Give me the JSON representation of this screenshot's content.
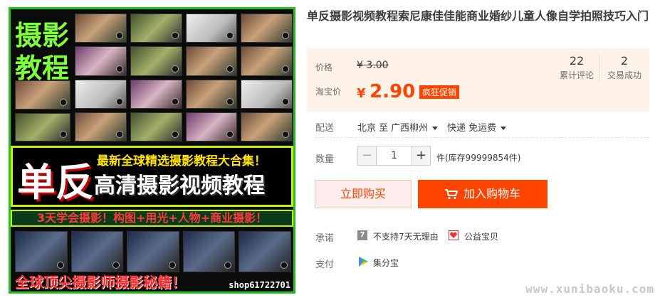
{
  "image": {
    "big_text_1": "摄影",
    "big_text_2": "教程",
    "banner_big": "单反",
    "banner_line1": "最新全球精选摄影教程大合集！",
    "banner_line2": "高清摄影视频教程",
    "strip_text": "3天学会摄影！构图+用光+人物+商业摄影！",
    "bottom_text": "全球顶尖摄影师摄影秘籍！",
    "shop_id": "shop61722701"
  },
  "product": {
    "title": "单反摄影视频教程索尼康佳佳能商业婚纱儿童人像自学拍照技巧入门"
  },
  "price": {
    "price_label": "价格",
    "original": "¥ 3.00",
    "taobao_label": "淘宝价",
    "currency": "¥",
    "current": "2.90",
    "promo_tag": "疯狂促销",
    "reviews_count": "22",
    "reviews_label": "累计评论",
    "deals_count": "2",
    "deals_label": "交易成功"
  },
  "delivery": {
    "label": "配送",
    "from": "北京 至",
    "to": "广西柳州",
    "method": "快递 免运费"
  },
  "quantity": {
    "label": "数量",
    "minus": "−",
    "value": "1",
    "plus": "+",
    "stock": "件(库存99999854件)"
  },
  "actions": {
    "buy_now": "立即购买",
    "add_cart": "加入购物车"
  },
  "promise": {
    "label": "承诺",
    "item1": "不支持7天无理由",
    "item1_icon": "7",
    "item2": "公益宝贝"
  },
  "payment": {
    "label": "支付",
    "item1": "集分宝"
  },
  "watermark": "www.xunibaoku.com",
  "colors": {
    "accent": "#ff4400",
    "price_bg": "#fff2e8",
    "frame_green": "#22c31e"
  }
}
